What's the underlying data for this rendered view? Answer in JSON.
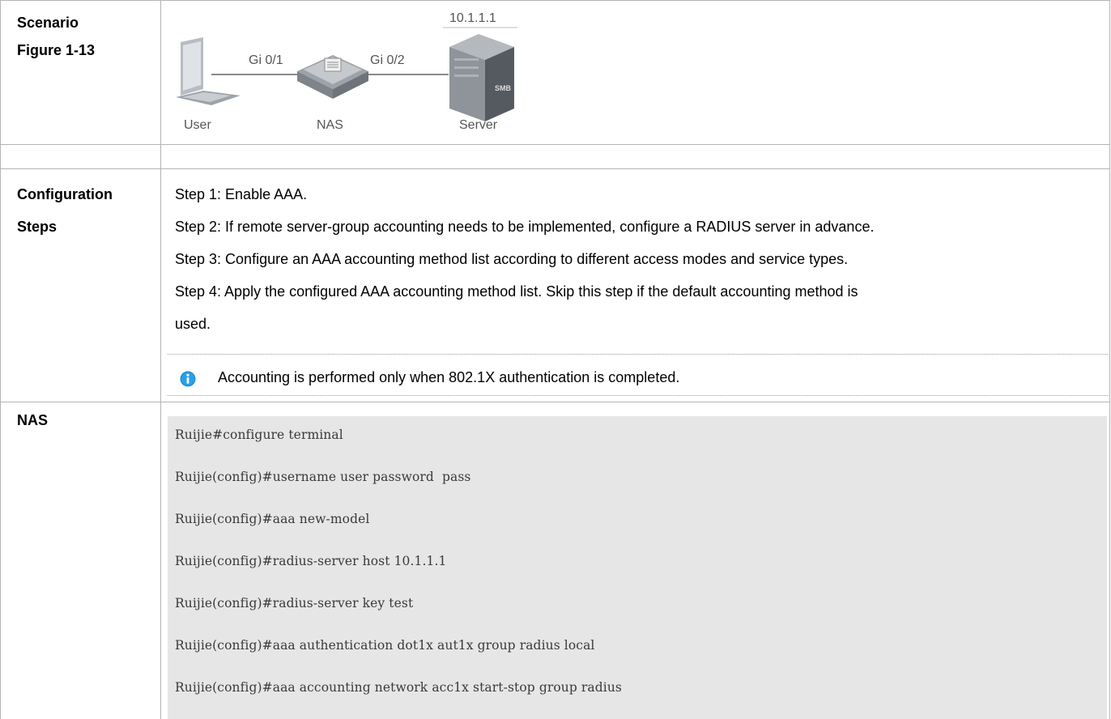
{
  "scenario": {
    "label_line1": "Scenario",
    "label_line2": "Figure 1-13",
    "diagram": {
      "ip": "10.1.1.1",
      "port_left": "Gi 0/1",
      "port_right": "Gi 0/2",
      "user_label": "User",
      "nas_label": "NAS",
      "server_label": "Server",
      "icons": [
        "laptop-icon",
        "switch-icon",
        "server-icon"
      ]
    }
  },
  "config_steps": {
    "label_line1": "Configuration",
    "label_line2": "Steps",
    "steps": [
      "Step 1: Enable AAA.",
      "Step 2: If remote server-group accounting needs to be implemented, configure a RADIUS server in advance.",
      "Step 3: Configure an AAA accounting method list according to different access modes and service types.",
      "Step 4: Apply the configured AAA accounting method list. Skip this step if the default accounting method is",
      "used."
    ],
    "note": "Accounting is performed only when 802.1X authentication is completed.",
    "note_icon": "info-icon",
    "note_icon_color": "#1e90d8"
  },
  "nas": {
    "label": "NAS",
    "code_lines": [
      "Ruijie#configure terminal",
      "Ruijie(config)#username user password  pass",
      "Ruijie(config)#aaa new-model",
      "Ruijie(config)#radius-server host 10.1.1.1",
      "Ruijie(config)#radius-server key test",
      "Ruijie(config)#aaa authentication dot1x aut1x group radius local",
      "Ruijie(config)#aaa accounting network acc1x start-stop group radius"
    ]
  }
}
